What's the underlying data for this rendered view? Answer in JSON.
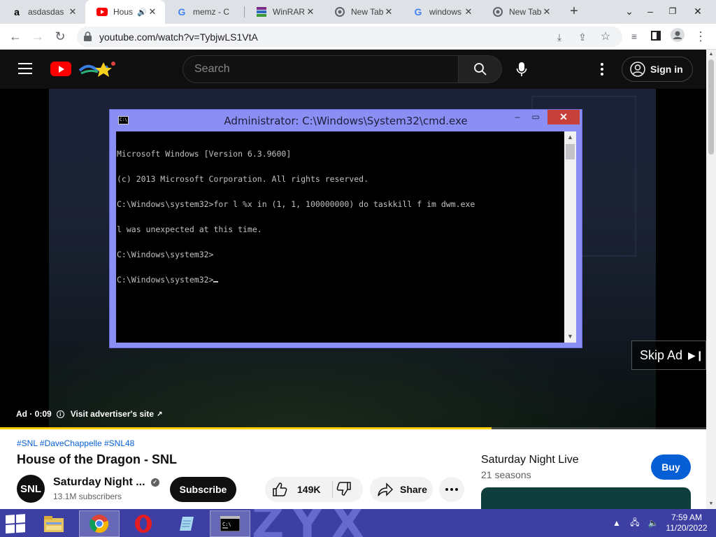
{
  "browser": {
    "tabs": [
      {
        "title": "asdasdas",
        "icon": "amazon-icon",
        "active": false
      },
      {
        "title": "House",
        "icon": "youtube-icon",
        "active": true,
        "audio": true
      },
      {
        "title": "memz - C",
        "icon": "google-icon",
        "active": false
      },
      {
        "title": "WinRAR",
        "icon": "winrar-icon",
        "active": false
      },
      {
        "title": "New Tab",
        "icon": "chrome-icon",
        "active": false
      },
      {
        "title": "windows",
        "icon": "google-icon",
        "active": false
      },
      {
        "title": "New Tab",
        "icon": "chrome-icon",
        "active": false
      }
    ],
    "url": "youtube.com/watch?v=TybjwLS1VtA"
  },
  "youtube": {
    "search_placeholder": "Search",
    "sign_in": "Sign in"
  },
  "cmd": {
    "title": "Administrator: C:\\Windows\\System32\\cmd.exe",
    "lines": [
      "Microsoft Windows [Version 6.3.9600]",
      "(c) 2013 Microsoft Corporation. All rights reserved.",
      "C:\\Windows\\system32>for l %x in (1, 1, 100000000) do taskkill f im dwm.exe",
      "l was unexpected at this time.",
      "C:\\Windows\\system32>",
      "C:\\Windows\\system32>"
    ]
  },
  "player": {
    "skip_ad": "Skip Ad",
    "ad_time": "Ad · 0:09",
    "visit_advertiser": "Visit advertiser's site",
    "progress": 0.696
  },
  "video": {
    "hashtags": "#SNL #DaveChappelle #SNL48",
    "title": "House of the Dragon - SNL",
    "channel": "Saturday Night ...",
    "channel_avatar": "SNL",
    "subscribers": "13.1M subscribers",
    "subscribe": "Subscribe",
    "likes": "149K",
    "share": "Share"
  },
  "sidebar_offer": {
    "title": "Saturday Night Live",
    "seasons": "21 seasons",
    "buy": "Buy"
  },
  "taskbar": {
    "time": "7:59 AM",
    "date": "11/20/2022",
    "wallpaper_text": "ZYX"
  },
  "colors": {
    "yt_red": "#ff0000",
    "progress_yellow": "#ffcc00",
    "cmd_frame": "#8b8ef2",
    "taskbar": "#3d3fa3",
    "buy_blue": "#065fd4"
  }
}
